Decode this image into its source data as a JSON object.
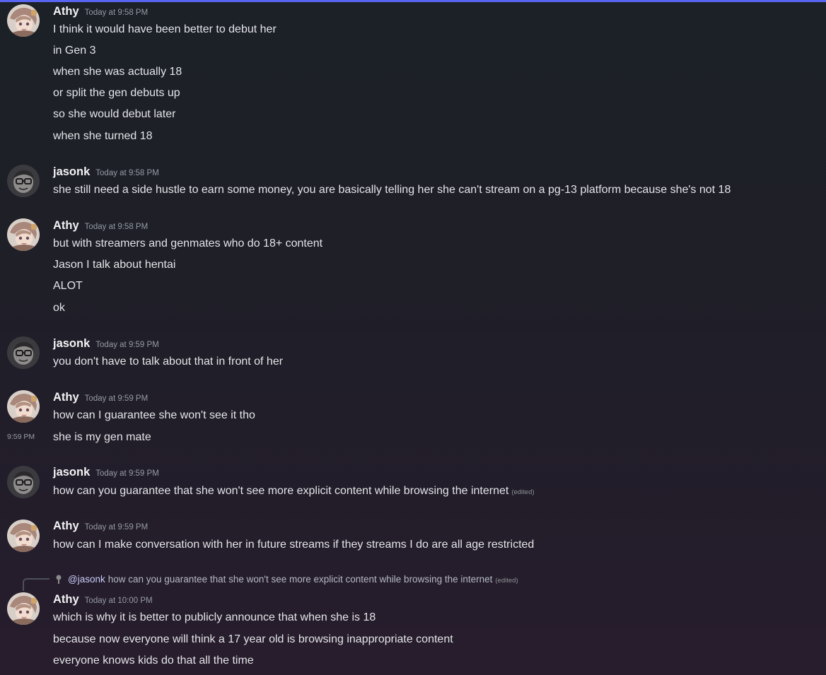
{
  "messages": [
    {
      "author": "Athy",
      "timestamp": "Today at 9:58 PM",
      "lines": [
        "I think it would have been better to debut her",
        "in Gen 3",
        "when she was actually 18",
        "or split the gen debuts up",
        "so she would debut later",
        "when she turned 18"
      ]
    },
    {
      "author": "jasonk",
      "timestamp": "Today at 9:58 PM",
      "lines": [
        "she still need a side hustle to earn some money, you are basically telling her she can't stream on a pg-13 platform because she's not 18"
      ]
    },
    {
      "author": "Athy",
      "timestamp": "Today at 9:58 PM",
      "lines": [
        "but with streamers and genmates who do 18+ content",
        "Jason I talk about hentai",
        "ALOT",
        "ok"
      ]
    },
    {
      "author": "jasonk",
      "timestamp": "Today at 9:59 PM",
      "lines": [
        "you don't have to talk about that in front of her"
      ]
    },
    {
      "author": "Athy",
      "timestamp": "Today at 9:59 PM",
      "lines": [
        "how can I guarantee she won't see it tho",
        "she is my gen mate"
      ],
      "hover_timestamp": "9:59 PM"
    },
    {
      "author": "jasonk",
      "timestamp": "Today at 9:59 PM",
      "lines": [
        "how can you guarantee that she won't see more explicit content while browsing the internet"
      ],
      "edited": "(edited)"
    },
    {
      "author": "Athy",
      "timestamp": "Today at 9:59 PM",
      "lines": [
        "how can I make conversation with her in future streams if they streams I do are all age restricted"
      ]
    },
    {
      "author": "Athy",
      "timestamp": "Today at 10:00 PM",
      "lines": [
        "which is why it is better to publicly announce that when she is 18",
        "because now everyone will think a 17 year old is browsing inappropriate content",
        "everyone knows kids do that all the time"
      ],
      "reply": {
        "mention": "@jasonk",
        "text": "how can you guarantee that she won't see more explicit content while browsing the internet",
        "edited": "(edited)"
      }
    }
  ],
  "colors": {
    "accent_bar": "#5865f2",
    "username": "#f2f3f5",
    "message_text": "#e3e5e8",
    "timestamp": "#949ba4"
  },
  "icons": {
    "athy_avatar": "anime-avatar-icon",
    "jasonk_avatar": "cartoon-avatar-icon"
  }
}
